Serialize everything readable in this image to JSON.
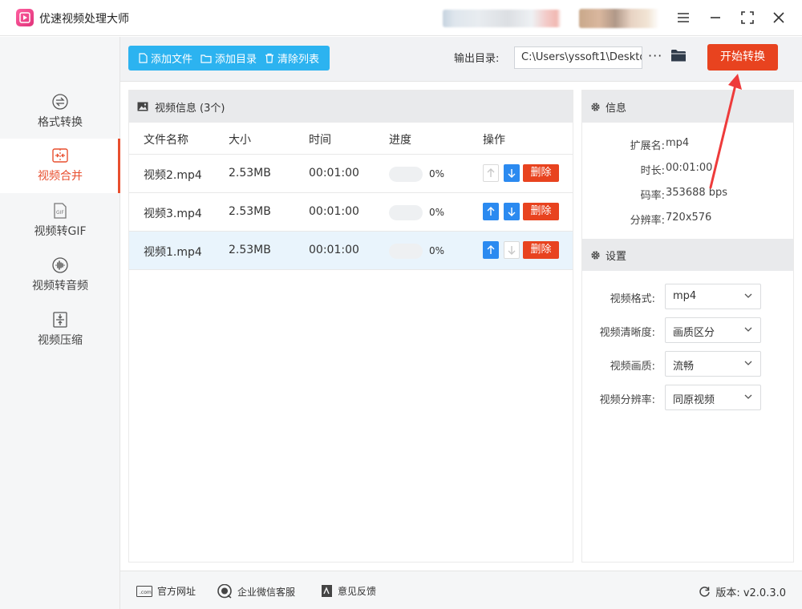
{
  "window": {
    "title": "优速视频处理大师",
    "menu_icon": "hamburger-menu-icon",
    "minimize_icon": "minimize-icon",
    "maximize_icon": "maximize-icon",
    "close_icon": "close-icon"
  },
  "sidebar": {
    "items": [
      {
        "label": "格式转换",
        "icon": "format-convert-icon",
        "active": false
      },
      {
        "label": "视频合并",
        "icon": "video-merge-icon",
        "active": true
      },
      {
        "label": "视频转GIF",
        "icon": "gif-icon",
        "active": false
      },
      {
        "label": "视频转音频",
        "icon": "audio-icon",
        "active": false
      },
      {
        "label": "视频压缩",
        "icon": "compress-icon",
        "active": false
      }
    ]
  },
  "toolbar": {
    "add_file": "添加文件",
    "add_dir": "添加目录",
    "clear_list": "清除列表",
    "output_label": "输出目录:",
    "output_path": "C:\\Users\\yssoft1\\Deskto",
    "more": "···",
    "start": "开始转换"
  },
  "file_panel": {
    "title": "视频信息",
    "count": "(3个)",
    "columns": [
      "文件名称",
      "大小",
      "时间",
      "进度",
      "操作"
    ],
    "rows": [
      {
        "name": "视频2.mp4",
        "size": "2.53MB",
        "time": "00:01:00",
        "progress": 0,
        "progress_text": "0%",
        "up_enabled": false,
        "down_enabled": true,
        "delete": "删除"
      },
      {
        "name": "视频3.mp4",
        "size": "2.53MB",
        "time": "00:01:00",
        "progress": 0,
        "progress_text": "0%",
        "up_enabled": true,
        "down_enabled": true,
        "delete": "删除"
      },
      {
        "name": "视频1.mp4",
        "size": "2.53MB",
        "time": "00:01:00",
        "progress": 0,
        "progress_text": "0%",
        "up_enabled": true,
        "down_enabled": false,
        "delete": "删除"
      }
    ]
  },
  "info": {
    "title": "信息",
    "rows": [
      {
        "label": "扩展名:",
        "value": "mp4"
      },
      {
        "label": "时长:",
        "value": "00:01:00"
      },
      {
        "label": "码率:",
        "value": "353688 bps"
      },
      {
        "label": "分辨率:",
        "value": "720x576"
      }
    ]
  },
  "settings": {
    "title": "设置",
    "rows": [
      {
        "label": "视频格式:",
        "value": "mp4"
      },
      {
        "label": "视频清晰度:",
        "value": "画质区分"
      },
      {
        "label": "视频画质:",
        "value": "流畅"
      },
      {
        "label": "视频分辨率:",
        "value": "同原视频"
      }
    ]
  },
  "footer": {
    "website": "官方网址",
    "wechat": "企业微信客服",
    "feedback": "意见反馈",
    "version": "版本: v2.0.3.0"
  },
  "colors": {
    "accent": "#e8431f",
    "blue_buttons": "#2cb3f0",
    "arrow_blue": "#2b8af0",
    "active_nav": "#e84f2f"
  }
}
